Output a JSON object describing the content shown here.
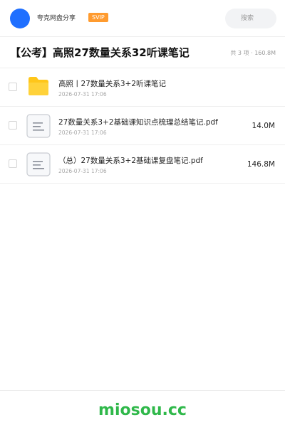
{
  "header": {
    "brand": "夸克网盘分享",
    "vip_badge": "SVIP",
    "search_placeholder": "搜索"
  },
  "folder": {
    "title": "【公考】高照27数量关系32听课笔记",
    "summary": "共 3 项 · 160.8M"
  },
  "files": [
    {
      "name": "高照丨27数量关系3+2听课笔记",
      "date": "2026-07-31 17:06",
      "size": "",
      "icon": "folder-icon"
    },
    {
      "name": "27数量关系3+2基础课知识点梳理总结笔记.pdf",
      "date": "2026-07-31 17:06",
      "size": "14.0M",
      "icon": "document-icon"
    },
    {
      "name": "（总）27数量关系3+2基础课复盘笔记.pdf",
      "date": "2026-07-31 17:06",
      "size": "146.8M",
      "icon": "document-icon"
    }
  ],
  "footer": {
    "watermark": "miosou.cc"
  },
  "colors": {
    "avatar": "#1f6fff",
    "vip": "#ff9b2f",
    "folder": "#ffc61a",
    "watermark": "#2fb84a"
  }
}
